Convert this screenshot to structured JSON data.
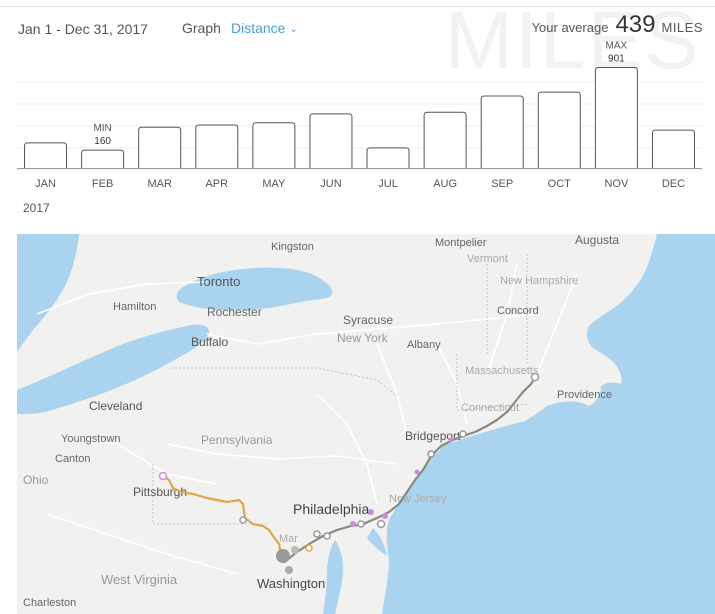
{
  "header": {
    "date_range": "Jan 1 - Dec 31, 2017",
    "graph_label": "Graph",
    "metric_selected": "Distance",
    "average_label": "Your average",
    "average_value": "439",
    "average_unit": "MILES",
    "watermark": "MILES"
  },
  "chart_data": {
    "type": "bar",
    "categories": [
      "JAN",
      "FEB",
      "MAR",
      "APR",
      "MAY",
      "JUN",
      "JUL",
      "AUG",
      "SEP",
      "OCT",
      "NOV",
      "DEC"
    ],
    "values": [
      225,
      160,
      365,
      385,
      405,
      485,
      180,
      500,
      645,
      680,
      901,
      340
    ],
    "ylim": [
      0,
      950
    ],
    "grid": true,
    "annotations": [
      {
        "category": "FEB",
        "label": "MIN",
        "value_text": "160"
      },
      {
        "category": "NOV",
        "label": "MAX",
        "value_text": "901"
      }
    ],
    "colors": {
      "bar_fill": "#ffffff",
      "bar_stroke": "#555555",
      "grid": "#eeeeee"
    }
  },
  "year_label": "2017",
  "map": {
    "labels": {
      "kingston": "Kingston",
      "montpelier": "Montpelier",
      "augusta": "Augusta",
      "vermont": "Vermont",
      "toronto": "Toronto",
      "new_hampshire": "New Hampshire",
      "hamilton": "Hamilton",
      "rochester": "Rochester",
      "syracuse": "Syracuse",
      "concord": "Concord",
      "buffalo": "Buffalo",
      "new_york": "New York",
      "albany": "Albany",
      "massachusetts": "Massachusetts",
      "cleveland": "Cleveland",
      "providence": "Providence",
      "connecticut": "Connecticut",
      "youngstown": "Youngstown",
      "pennsylvania": "Pennsylvania",
      "bridgeport": "Bridgeport",
      "canton": "Canton",
      "ohio": "Ohio",
      "pittsburgh": "Pittsburgh",
      "new_jersey": "New Jersey",
      "philadelphia": "Philadelphia",
      "maryland": "Mar",
      "west_virginia": "West Virginia",
      "washington": "Washington",
      "charleston": "Charleston"
    },
    "colors": {
      "land": "#f1f1ef",
      "water": "#a9d3ee",
      "route_orange": "#e0a64a",
      "route_gray": "#8a8a80",
      "road": "#ffffff",
      "marker_purple": "#c98be0",
      "marker_gray": "#9a9a9a"
    }
  }
}
